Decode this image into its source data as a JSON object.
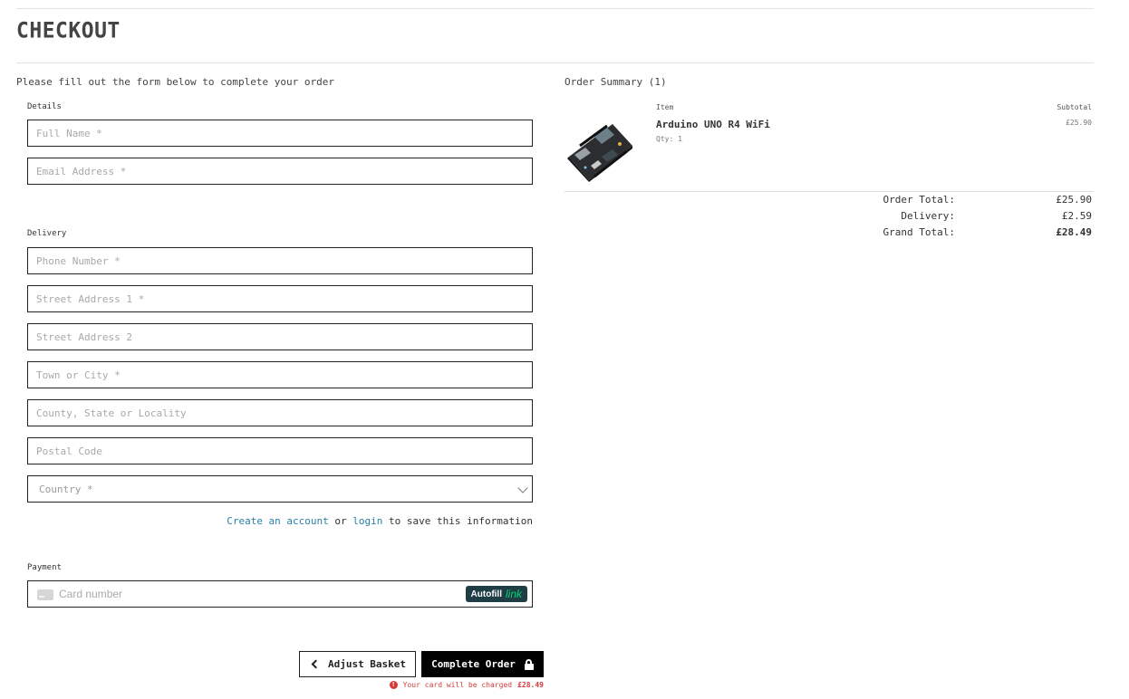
{
  "page": {
    "title": "CHECKOUT",
    "intro": "Please fill out the form below to complete your order"
  },
  "form": {
    "details_label": "Details",
    "delivery_label": "Delivery",
    "payment_label": "Payment",
    "fields": {
      "full_name": {
        "placeholder": "Full Name *",
        "value": ""
      },
      "email": {
        "placeholder": "Email Address *",
        "value": ""
      },
      "phone": {
        "placeholder": "Phone Number *",
        "value": ""
      },
      "street1": {
        "placeholder": "Street Address 1 *",
        "value": ""
      },
      "street2": {
        "placeholder": "Street Address 2",
        "value": ""
      },
      "town": {
        "placeholder": "Town or City *",
        "value": ""
      },
      "county": {
        "placeholder": "County, State or Locality",
        "value": ""
      },
      "postal": {
        "placeholder": "Postal Code",
        "value": ""
      },
      "country": {
        "selected": "Country *"
      }
    },
    "save_info": {
      "create_account": "Create an account",
      "or": "or",
      "login": "login",
      "suffix": "to save this information"
    },
    "card": {
      "placeholder": "Card number",
      "autofill": "Autofill",
      "link": "link"
    }
  },
  "actions": {
    "adjust_basket": "Adjust Basket",
    "complete_order": "Complete Order",
    "charge_notice": "Your card will be charged",
    "charge_amount": "£28.49"
  },
  "summary": {
    "title": "Order Summary (1)",
    "col_item": "Item",
    "col_subtotal": "Subtotal",
    "items": [
      {
        "name": "Arduino UNO R4 WiFi",
        "qty": "Qty: 1",
        "subtotal": "£25.90"
      }
    ],
    "order_total_label": "Order Total:",
    "order_total": "£25.90",
    "delivery_label": "Delivery:",
    "delivery": "£2.59",
    "grand_total_label": "Grand Total:",
    "grand_total": "£28.49"
  },
  "colors": {
    "link": "#2a7fa8",
    "error": "#d43a3a",
    "autofill_bg": "#1e3d44",
    "link_green": "#00d66f"
  }
}
